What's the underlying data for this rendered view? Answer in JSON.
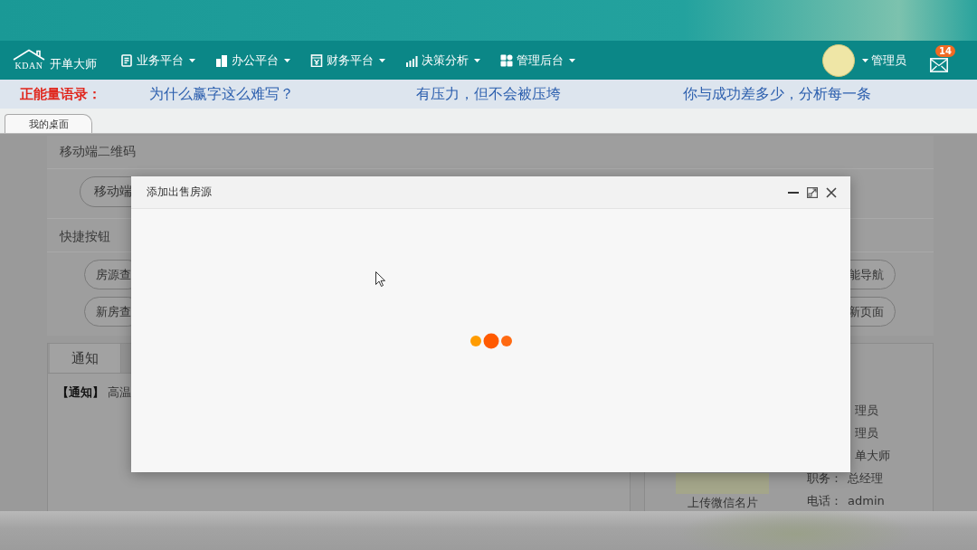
{
  "nav": {
    "logo_mark": "KDAN",
    "logo_name": "开单大师",
    "menus": [
      {
        "label": "业务平台"
      },
      {
        "label": "办公平台"
      },
      {
        "label": "财务平台"
      },
      {
        "label": "决策分析"
      },
      {
        "label": "管理后台"
      }
    ],
    "user": {
      "name": "管理员"
    },
    "mail": {
      "badge": "14"
    }
  },
  "ticker": {
    "label": "正能量语录：",
    "quotes": [
      "为什么赢字这么难写？",
      "有压力，但不会被压垮",
      "你与成功差多少，分析每一条"
    ]
  },
  "page_tabs": [
    {
      "label": "我的桌面",
      "selected": true
    }
  ],
  "desktop": {
    "qr_section": {
      "title": "移动端二维码",
      "buttons": [
        "移动端"
      ]
    },
    "quick_section": {
      "title": "快捷按钮",
      "rows": [
        {
          "left": "房源查",
          "right": "能导航"
        },
        {
          "left": "新房查",
          "right": "新页面"
        }
      ]
    },
    "notice_tabs": [
      {
        "label": "通知",
        "selected": true
      }
    ],
    "notices": [
      "**【通知】** 高温"
    ],
    "profile": {
      "upload_label": "上传微信名片",
      "fields": [
        {
          "value": "理员"
        },
        {
          "value": "理员"
        },
        {
          "value": "单大师"
        },
        {
          "label": "职务：",
          "value": "总经理"
        },
        {
          "label": "电话：",
          "value": "admin"
        }
      ]
    }
  },
  "dialog": {
    "title": "添加出售房源",
    "loading": true
  }
}
